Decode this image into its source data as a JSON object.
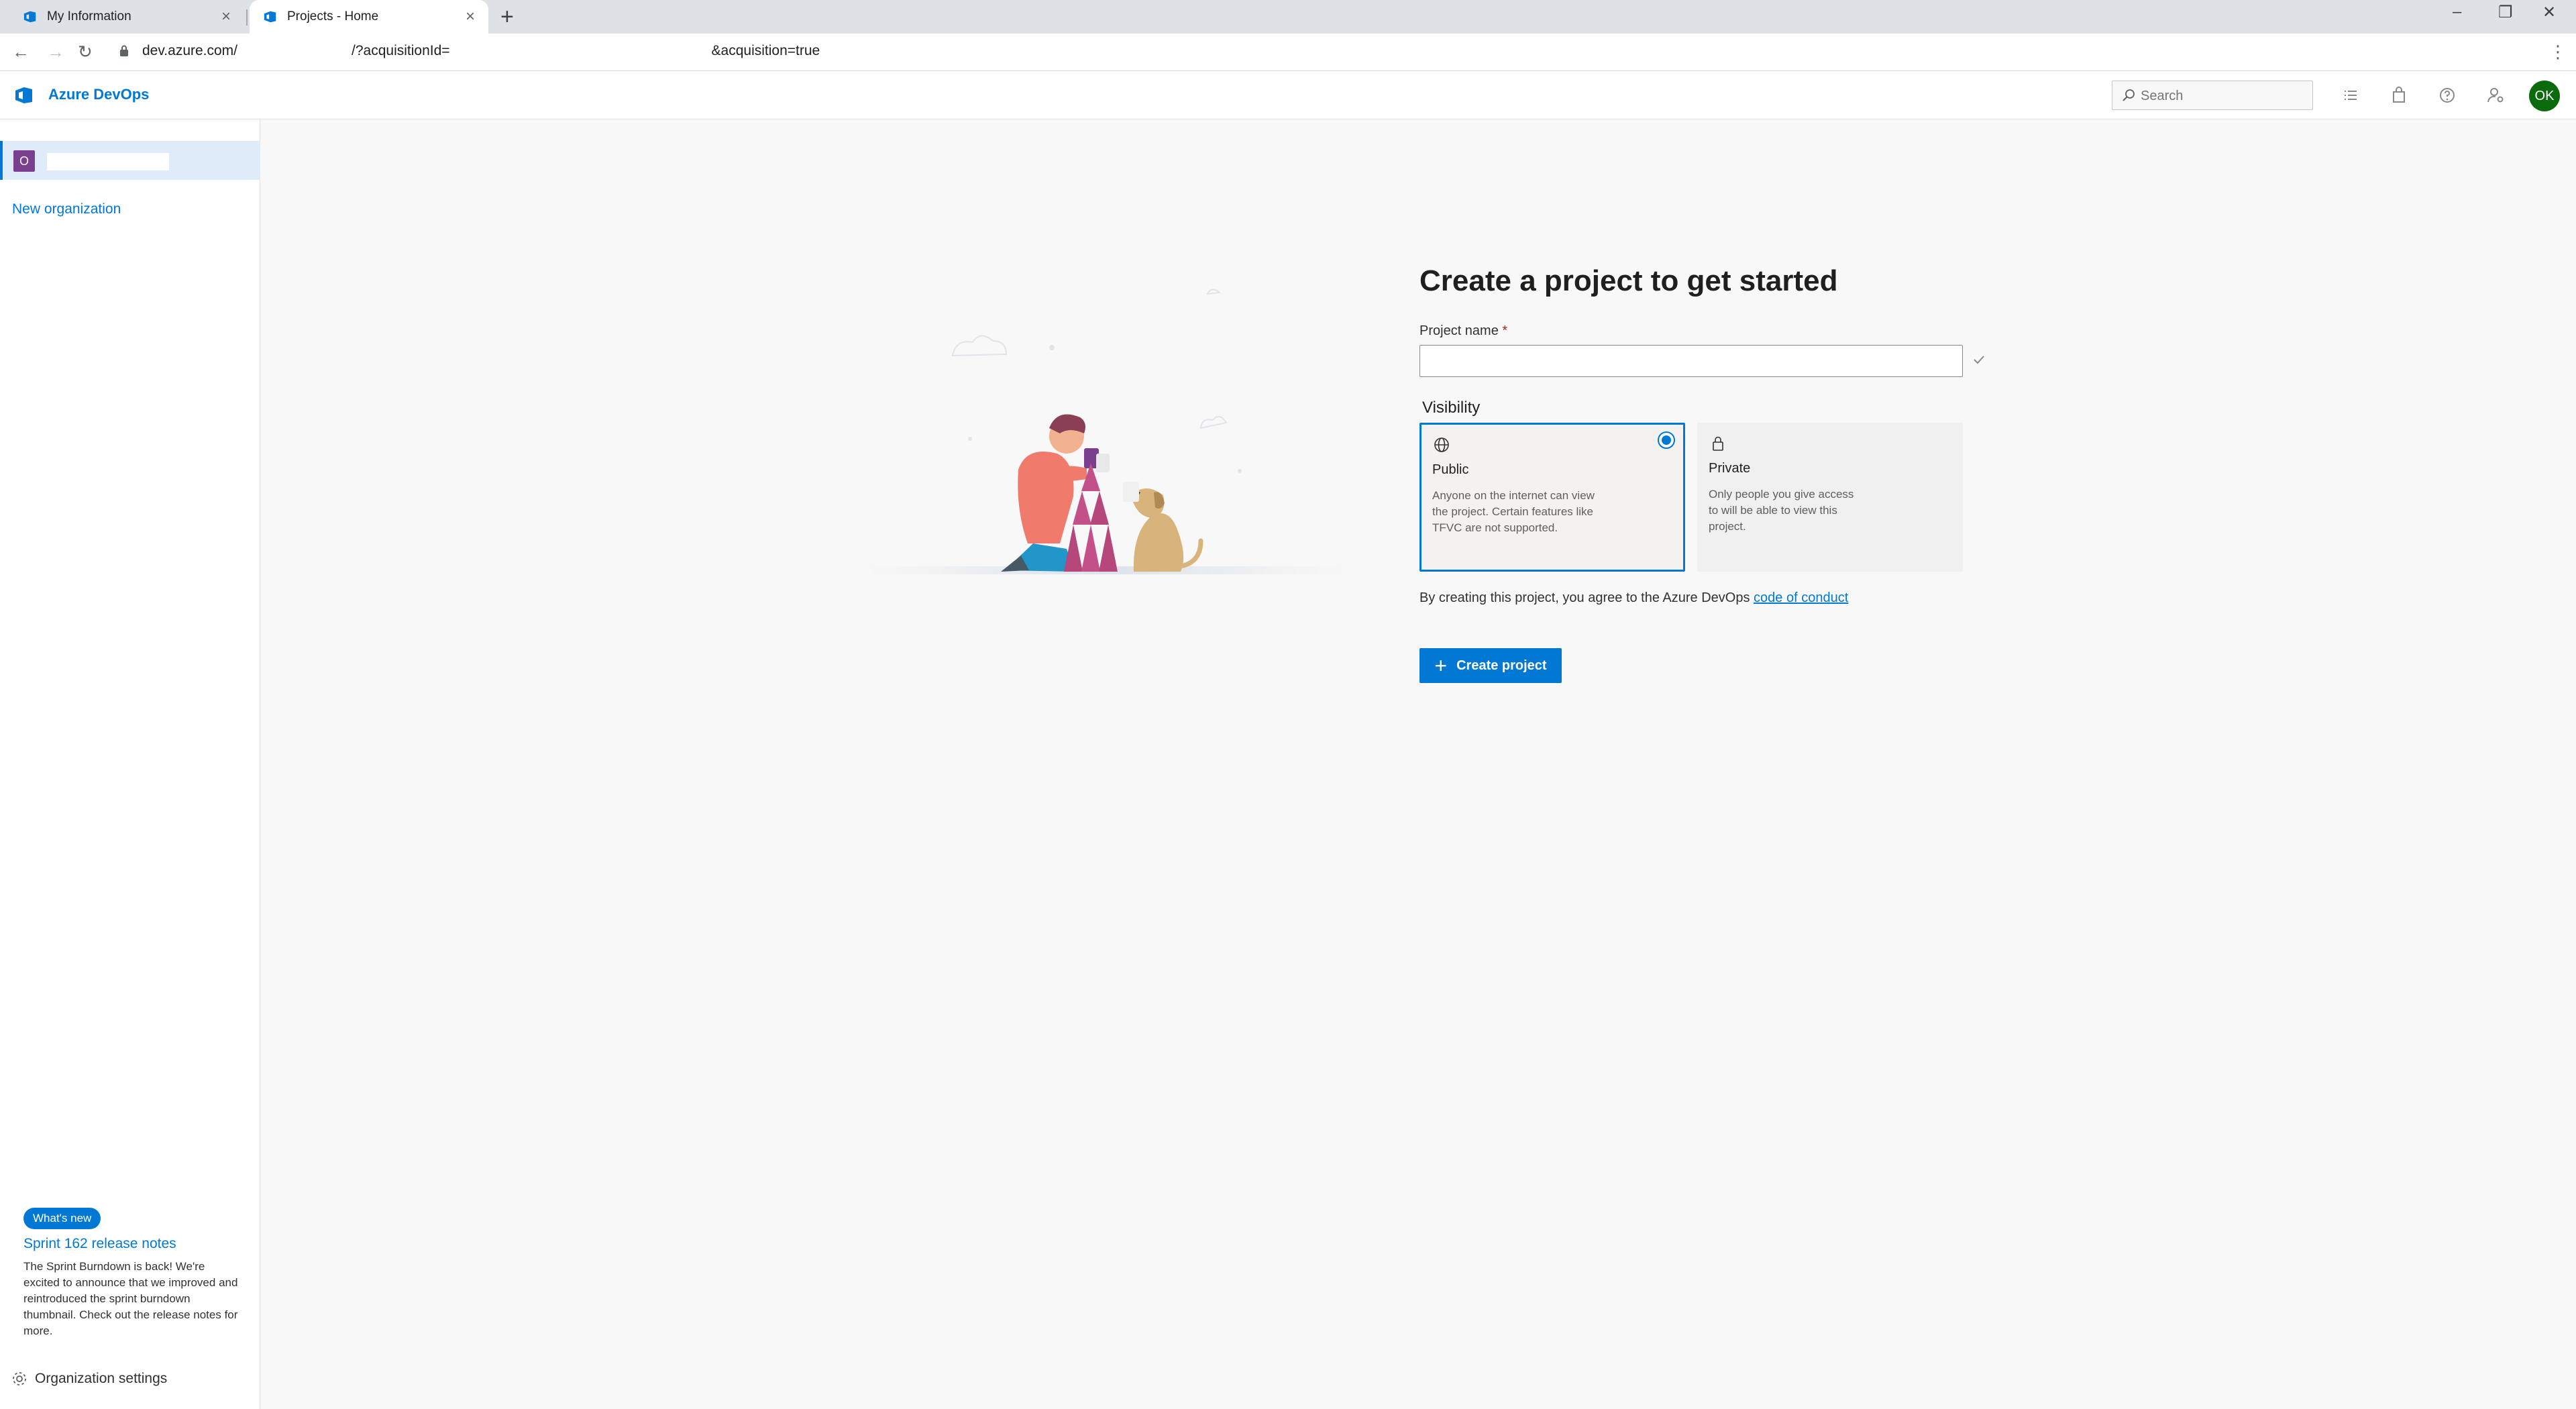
{
  "browser": {
    "tabs": [
      {
        "title": "My Information",
        "active": false
      },
      {
        "title": "Projects - Home",
        "active": true
      }
    ],
    "url_prefix": "dev.azure.com/",
    "url_middle": "/?acquisitionId=",
    "url_suffix": "&acquisition=true",
    "profile_initial": "O",
    "window_controls": [
      "–",
      "❐",
      "✕"
    ]
  },
  "header": {
    "brand": "Azure DevOps",
    "search_placeholder": "Search",
    "avatar_initials": "OK"
  },
  "sidebar": {
    "org_initial": "O",
    "new_org_label": "New organization",
    "whats_new_label": "What's new",
    "release_link": "Sprint 162 release notes",
    "release_text": "The Sprint Burndown is back! We're excited to announce that we improved and reintroduced the sprint burndown thumbnail. Check out the release notes for more.",
    "settings_label": "Organization settings"
  },
  "main": {
    "heading": "Create a project to get started",
    "project_name_label": "Project name",
    "required_marker": "*",
    "project_name_value": "",
    "visibility_label": "Visibility",
    "visibility_options": [
      {
        "title": "Public",
        "description": "Anyone on the internet can view the project. Certain features like TFVC are not supported.",
        "selected": true
      },
      {
        "title": "Private",
        "description": "Only people you give access to will be able to view this project.",
        "selected": false
      }
    ],
    "agree_text": "By creating this project, you agree to the Azure DevOps ",
    "agree_link": "code of conduct",
    "create_button": "Create project"
  },
  "colors": {
    "accent": "#0078d4",
    "org_badge": "#7a3f8f",
    "avatar": "#0b6a0b"
  }
}
